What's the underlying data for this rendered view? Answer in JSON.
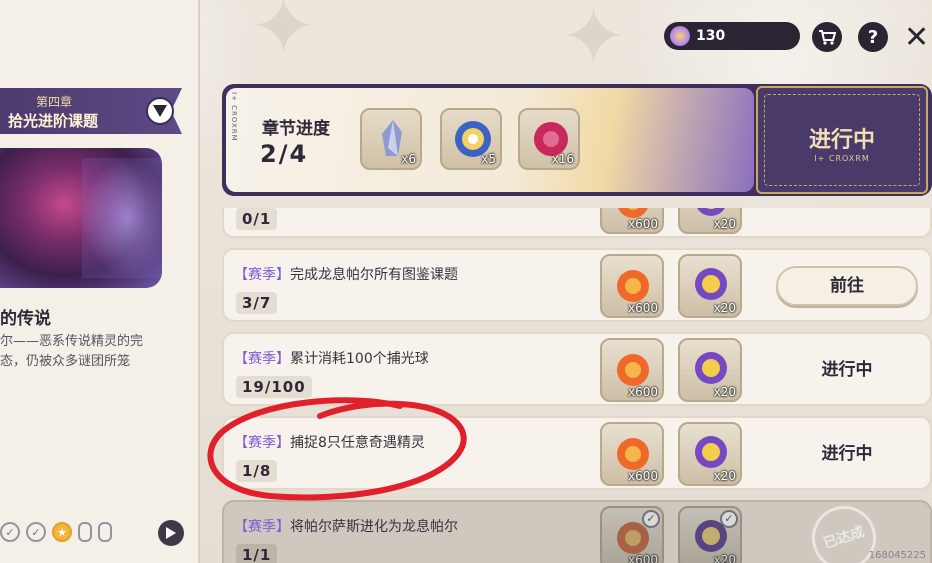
{
  "topbar": {
    "currency_amount": "130",
    "icons": [
      "cart-icon",
      "help-icon",
      "close-icon"
    ]
  },
  "chapter": {
    "number_label": "第四章",
    "name": "拾光进阶课题",
    "legend_title": "的传说",
    "legend_desc_line1": "尔——恶系传说精灵的完",
    "legend_desc_line2": "态，仍被众多谜团所笼"
  },
  "banner": {
    "progress_label": "章节进度",
    "progress_value": "2/4",
    "rewards": [
      {
        "qty": "x6",
        "icon": "crystal-icon"
      },
      {
        "qty": "x5",
        "icon": "orb-icon"
      },
      {
        "qty": "x16",
        "icon": "ruby-icon"
      }
    ],
    "status_label": "进行中",
    "tag_text": "I+ CROXRM"
  },
  "tasks": [
    {
      "title_tag": "",
      "title_text": "",
      "progress": "0/1",
      "rewards": [
        {
          "qty": "x600"
        },
        {
          "qty": "x20"
        }
      ],
      "action": ""
    },
    {
      "title_tag": "【赛季】",
      "title_text": "完成龙息帕尔所有图鉴课题",
      "progress": "3/7",
      "rewards": [
        {
          "qty": "x600"
        },
        {
          "qty": "x20"
        }
      ],
      "action": "前往"
    },
    {
      "title_tag": "【赛季】",
      "title_text": "累计消耗100个捕光球",
      "progress": "19/100",
      "rewards": [
        {
          "qty": "x600"
        },
        {
          "qty": "x20"
        }
      ],
      "action": "进行中"
    },
    {
      "title_tag": "【赛季】",
      "title_text": "捕捉8只任意奇遇精灵",
      "progress": "1/8",
      "rewards": [
        {
          "qty": "x600"
        },
        {
          "qty": "x20"
        }
      ],
      "action": "进行中"
    },
    {
      "title_tag": "【赛季】",
      "title_text": "将帕尔萨斯进化为龙息帕尔",
      "progress": "1/1",
      "rewards": [
        {
          "qty": "x600"
        },
        {
          "qty": "x20"
        }
      ],
      "action": "已达成"
    }
  ],
  "watermark": "168045225",
  "colors": {
    "accent_purple": "#4c3b6e",
    "tag_purple": "#7c5bd6",
    "annotation_red": "#e0202a"
  }
}
